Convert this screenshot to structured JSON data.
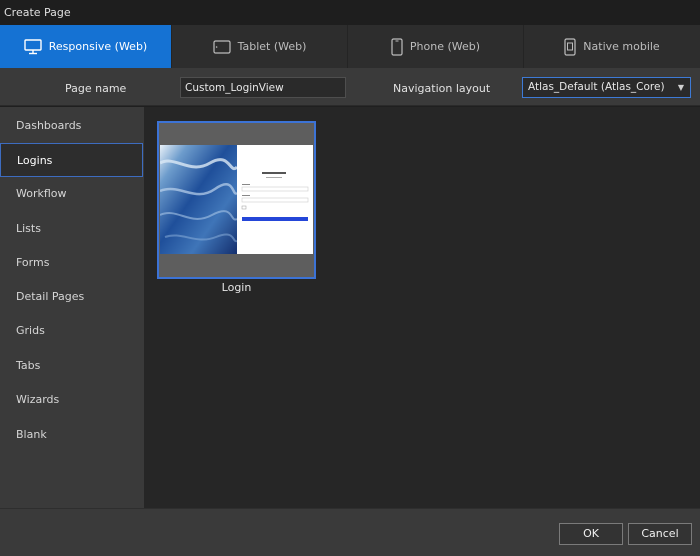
{
  "window": {
    "title": "Create Page"
  },
  "tabs": [
    {
      "label": "Responsive (Web)",
      "icon": "monitor-icon"
    },
    {
      "label": "Tablet (Web)",
      "icon": "tablet-icon"
    },
    {
      "label": "Phone (Web)",
      "icon": "phone-icon"
    },
    {
      "label": "Native mobile",
      "icon": "mobile-app-icon"
    }
  ],
  "form": {
    "page_name_label": "Page name",
    "page_name_value": "Custom_LoginView",
    "nav_layout_label": "Navigation layout",
    "nav_layout_value": "Atlas_Default (Atlas_Core)"
  },
  "sidebar": {
    "items": [
      {
        "label": "Dashboards"
      },
      {
        "label": "Logins"
      },
      {
        "label": "Workflow"
      },
      {
        "label": "Lists"
      },
      {
        "label": "Forms"
      },
      {
        "label": "Detail Pages"
      },
      {
        "label": "Grids"
      },
      {
        "label": "Tabs"
      },
      {
        "label": "Wizards"
      },
      {
        "label": "Blank"
      }
    ]
  },
  "templates": [
    {
      "label": "Login"
    }
  ],
  "footer": {
    "ok_label": "OK",
    "cancel_label": "Cancel"
  },
  "colors": {
    "accent": "#1572d3",
    "selection_border": "#3c73d6",
    "panel": "#3a3a3a",
    "background": "#262626"
  }
}
